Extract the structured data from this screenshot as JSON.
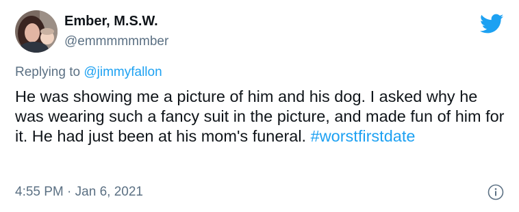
{
  "author": {
    "display_name": "Ember, M.S.W.",
    "handle": "@emmmmmmber"
  },
  "reply": {
    "prefix": "Replying to",
    "mention": "@jimmyfallon"
  },
  "tweet": {
    "text": "He was showing me a picture of him and his dog. I asked why he was wearing such a fancy suit in the picture, and made fun of him for it. He had just been at his mom's funeral.",
    "hashtag": "#worstfirstdate"
  },
  "meta": {
    "time": "4:55 PM",
    "separator": "·",
    "date": "Jan 6, 2021"
  },
  "icons": {
    "logo": "twitter-bird-icon",
    "info": "info-icon"
  },
  "colors": {
    "link": "#1da1f2",
    "secondary_text": "#5b7083",
    "primary_text": "#0f1419"
  }
}
